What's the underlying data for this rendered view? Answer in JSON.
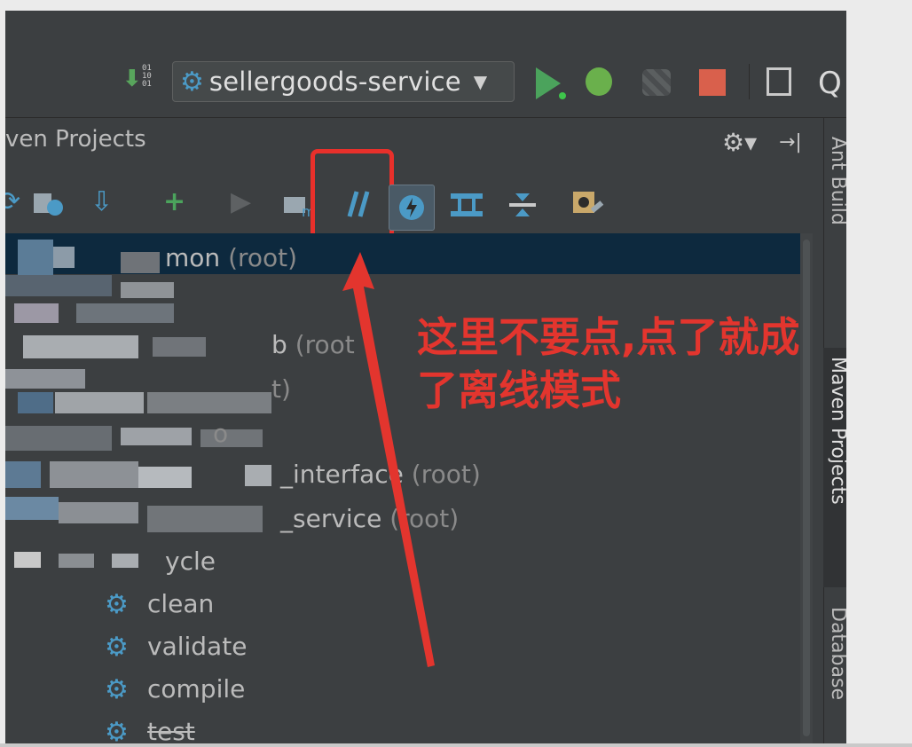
{
  "run_config": {
    "name": "sellergoods-service",
    "sort_digits": [
      "01",
      "10",
      "01"
    ]
  },
  "panel": {
    "title": "ven Projects",
    "gear_glyph": "⚙▾",
    "hide_glyph": "→|"
  },
  "toolbar_icons": [
    "reimport-icon",
    "generate-sources-icon",
    "add-maven-project-icon",
    "run-maven-build-icon",
    "execute-goal-icon",
    "toggle-offline-mode-icon",
    "skip-tests-icon",
    "show-dependencies-icon",
    "collapse-all-icon",
    "maven-settings-icon"
  ],
  "tree": {
    "rows": [
      {
        "text": "mon",
        "suffix": "(root)"
      },
      {
        "text": "b",
        "suffix": "(root"
      },
      {
        "text": "t)",
        "suffix": ""
      },
      {
        "text": "o",
        "suffix": ""
      },
      {
        "text": "_interface",
        "suffix": "(root)"
      },
      {
        "text": "_service",
        "suffix": "(root)"
      },
      {
        "text": "ycle",
        "suffix": ""
      },
      {
        "text": "clean",
        "suffix": ""
      },
      {
        "text": "validate",
        "suffix": ""
      },
      {
        "text": "compile",
        "suffix": ""
      },
      {
        "text": "test",
        "suffix": ""
      }
    ]
  },
  "side_tabs": {
    "ant": "Ant Build",
    "maven": "Maven Projects",
    "database": "Database"
  },
  "annotation": {
    "line1": "这里不要点,点了就成",
    "line2": "了离线模式",
    "color": "#e3352e"
  }
}
